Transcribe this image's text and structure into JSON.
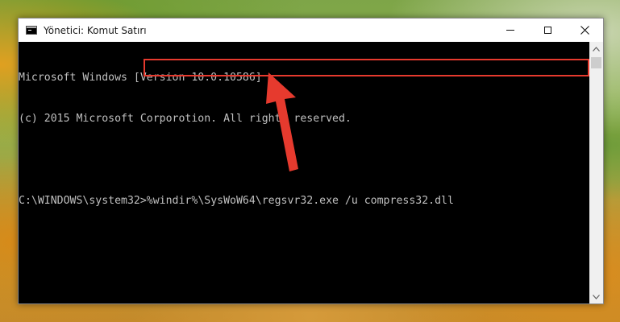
{
  "window": {
    "title": "Yönetici: Komut Satırı",
    "icons": {
      "app": "cmd-icon",
      "minimize": "minimize-icon",
      "maximize": "maximize-icon",
      "close": "close-icon"
    }
  },
  "console": {
    "lines": [
      "Microsoft Windows [Version 10.0.10586]",
      "(c) 2015 Microsoft Corporotion. All rights reserved.",
      ""
    ],
    "prompt": "C:\\WINDOWS\\system32>",
    "command": "%windir%\\SysWoW64\\regsvr32.exe /u compress32.dll"
  },
  "annotation": {
    "highlight_color": "#e63a2e",
    "arrow_color": "#e63a2e"
  }
}
